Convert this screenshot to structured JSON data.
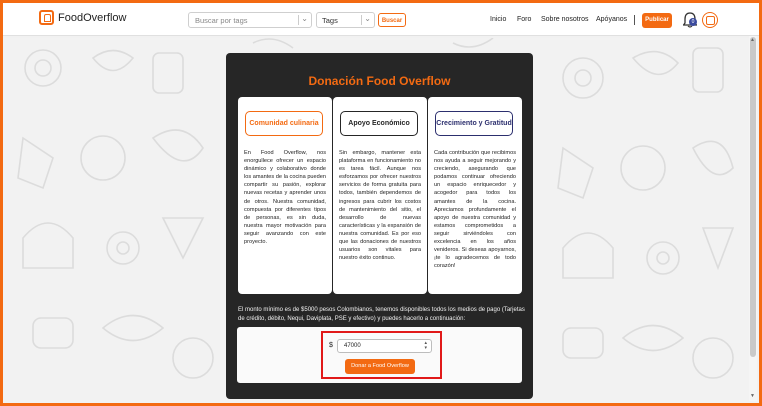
{
  "navbar": {
    "brand": "FoodOverflow",
    "search_placeholder": "Buscar por tags",
    "tags_label": "Tags",
    "search_button": "Buscar",
    "links": [
      "Inicio",
      "Foro",
      "Sobre nosotros",
      "Apóyanos"
    ],
    "publish_button": "Publicar",
    "notification_count": "0"
  },
  "donation": {
    "title": "Donación Food Overflow",
    "columns": [
      {
        "heading": "Comunidad culinaria",
        "text": "En Food Overflow, nos enorgullece ofrecer un espacio dinámico y colaborativo donde los amantes de la cocina pueden compartir su pasión, explorar nuevas recetas y aprender unos de otros. Nuestra comunidad, compuesta por diferentes tipos de personas, es sin duda, nuestra mayor motivación para seguir avanzando con este proyecto."
      },
      {
        "heading": "Apoyo Económico",
        "text": "Sin embargo, mantener esta plataforma en funcionamiento no es tarea fácil. Aunque nos esforzamos por ofrecer nuestros servicios de forma gratuita para todos, también dependemos de ingresos para cubrir los costos de mantenimiento del sitio, el desarrollo de nuevas características y la expansión de nuestra comunidad. Es por eso que las donaciones de nuestros usuarios son vitales para nuestro éxito continuo."
      },
      {
        "heading": "Crecimiento y Gratitud",
        "text": "Cada contribución que recibimos nos ayuda a seguir mejorando y creciendo, asegurando que podamos continuar ofreciendo un espacio enriquecedor y acogedor para todos los amantes de la cocina. Apreciamos profundamente el apoyo de nuestra comunidad y estamos comprometidos a seguir sirviéndoles con excelencia en los años venideros. Si deseas apoyarnos, ¡te lo agradecemos de todo corazón!"
      }
    ],
    "info_text": "El monto mínimo es de $5000 pesos Colombianos, tenemos disponibles todos los medios de pago (Tarjetas de crédito, débito, Nequi, Daviplata, PSE y efectivo) y puedes hacerlo a continuación:",
    "currency_symbol": "$",
    "amount_value": "47000",
    "donate_button": "Donar a Food Overflow"
  },
  "colors": {
    "accent": "#f36a12",
    "column1_border": "#f36a12",
    "column2_border": "#262626",
    "column3_border": "#2c2f6e",
    "highlight": "#e11919"
  }
}
